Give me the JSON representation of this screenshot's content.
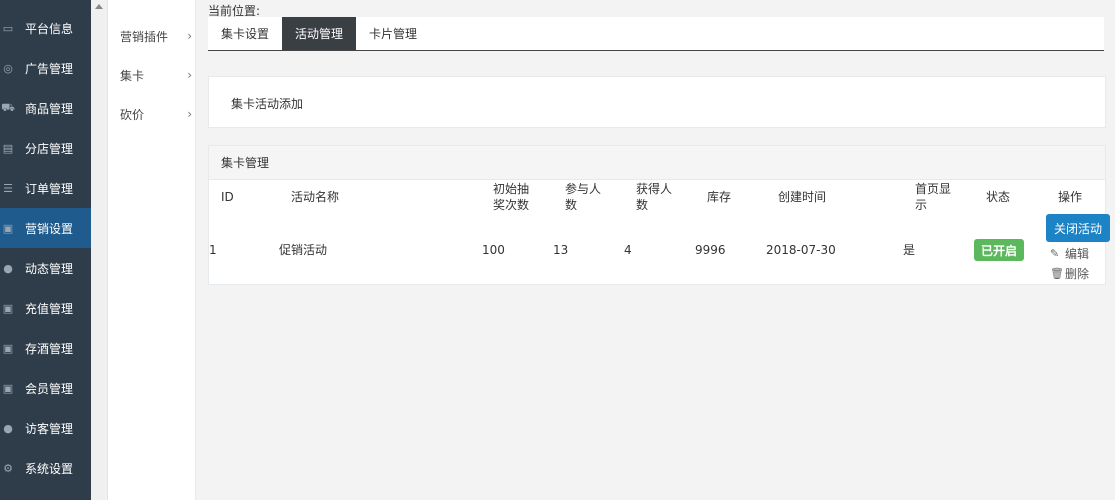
{
  "sidebar": {
    "items": [
      {
        "label": "平台信息",
        "icon": "monitor-icon",
        "glyph": "▭",
        "active": false
      },
      {
        "label": "广告管理",
        "icon": "lifebuoy-icon",
        "glyph": "◎",
        "active": false
      },
      {
        "label": "商品管理",
        "icon": "cart-icon",
        "glyph": "⛟",
        "active": false
      },
      {
        "label": "分店管理",
        "icon": "building-icon",
        "glyph": "▤",
        "active": false
      },
      {
        "label": "订单管理",
        "icon": "list-icon",
        "glyph": "☰",
        "active": false
      },
      {
        "label": "营销设置",
        "icon": "gift-icon",
        "glyph": "▣",
        "active": true
      },
      {
        "label": "动态管理",
        "icon": "user-icon",
        "glyph": "●",
        "active": false
      },
      {
        "label": "充值管理",
        "icon": "gift-icon",
        "glyph": "▣",
        "active": false
      },
      {
        "label": "存酒管理",
        "icon": "gift-icon",
        "glyph": "▣",
        "active": false
      },
      {
        "label": "会员管理",
        "icon": "gift-icon",
        "glyph": "▣",
        "active": false
      },
      {
        "label": "访客管理",
        "icon": "user-icon",
        "glyph": "●",
        "active": false
      },
      {
        "label": "系统设置",
        "icon": "gear-icon",
        "glyph": "⚙",
        "active": false
      }
    ]
  },
  "submenu": {
    "items": [
      {
        "label": "营销插件"
      },
      {
        "label": "集卡"
      },
      {
        "label": "砍价"
      }
    ],
    "chevron": "›"
  },
  "breadcrumb": "当前位置:",
  "tabs": [
    {
      "label": "集卡设置",
      "active": false
    },
    {
      "label": "活动管理",
      "active": true
    },
    {
      "label": "卡片管理",
      "active": false
    }
  ],
  "add_link": "集卡活动添加",
  "table": {
    "title": "集卡管理",
    "headers": {
      "id": "ID",
      "name": "活动名称",
      "draws_1": "初始抽",
      "draws_2": "奖次数",
      "participants_1": "参与人",
      "participants_2": "数",
      "winners_1": "获得人",
      "winners_2": "数",
      "stock": "库存",
      "created": "创建时间",
      "homepage_1": "首页显",
      "homepage_2": "示",
      "status": "状态",
      "actions": "操作"
    },
    "rows": [
      {
        "id": "1",
        "name": "促销活动",
        "draws": "100",
        "participants": "13",
        "winners": "4",
        "stock": "9996",
        "created": "2018-07-30",
        "homepage": "是",
        "status": "已开启",
        "close_label": "关闭活动",
        "edit_label": "编辑",
        "delete_label": "删除"
      }
    ]
  },
  "colors": {
    "sidebar_bg": "#2f3d4a",
    "sidebar_active": "#1f5b8c",
    "tab_active": "#3a3f44",
    "status_on": "#5cb85c",
    "primary_button": "#1c84c6"
  }
}
